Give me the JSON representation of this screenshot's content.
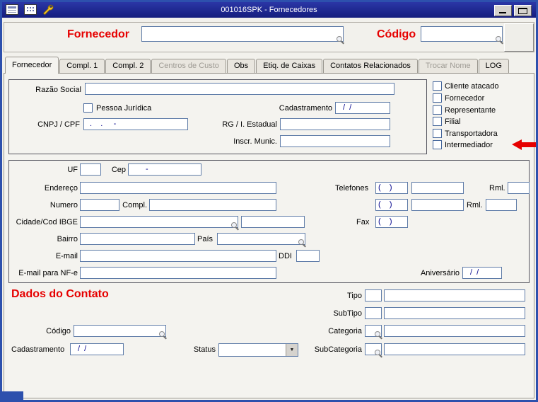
{
  "window": {
    "title": "001016SPK - Fornecedores"
  },
  "header": {
    "fornecedor_label": "Fornecedor",
    "codigo_label": "Código"
  },
  "tabs": [
    {
      "label": "Fornecedor",
      "state": "active"
    },
    {
      "label": "Compl. 1",
      "state": "normal"
    },
    {
      "label": "Compl. 2",
      "state": "normal"
    },
    {
      "label": "Centros de Custo",
      "state": "disabled"
    },
    {
      "label": "Obs",
      "state": "normal"
    },
    {
      "label": "Etiq. de Caixas",
      "state": "normal"
    },
    {
      "label": "Contatos Relacionados",
      "state": "normal"
    },
    {
      "label": "Trocar Nome",
      "state": "disabled"
    },
    {
      "label": "LOG",
      "state": "normal"
    }
  ],
  "identification": {
    "razao_social_label": "Razão Social",
    "pessoa_juridica_label": "Pessoa Jurídica",
    "cadastramento_label": "Cadastramento",
    "cadastramento_mask": "/  /",
    "cnpj_label": "CNPJ / CPF",
    "cnpj_mask": ".    .     -",
    "rg_label": "RG / I. Estadual",
    "inscr_label": "Inscr. Munic.",
    "flags": [
      "Cliente atacado",
      "Fornecedor",
      "Representante",
      "Filial",
      "Transportadora",
      "Intermediador"
    ]
  },
  "address": {
    "uf_label": "UF",
    "cep_label": "Cep",
    "cep_mask": "-",
    "endereco_label": "Endereço",
    "numero_label": "Numero",
    "compl_label": "Compl.",
    "cidade_label": "Cidade/Cod IBGE",
    "bairro_label": "Bairro",
    "pais_label": "País",
    "email_label": "E-mail",
    "ddi_label": "DDI",
    "email_nfe_label": "E-mail para NF-e",
    "telefones_label": "Telefones",
    "phone_mask": "(    )",
    "rml_label": "Rml.",
    "fax_label": "Fax",
    "aniversario_label": "Aniversário",
    "aniversario_mask": "/  /"
  },
  "contact": {
    "title": "Dados do Contato",
    "codigo_label": "Código",
    "cadastramento_label": "Cadastramento",
    "cadastramento_mask": "/  /",
    "status_label": "Status",
    "tipo_label": "Tipo",
    "subtipo_label": "SubTipo",
    "categoria_label": "Categoria",
    "subcategoria_label": "SubCategoria"
  },
  "colors": {
    "accent_red": "#e60000",
    "titlebar": "#151d7e",
    "mask_text": "#00008b",
    "field_border": "#5f7ca8"
  },
  "icons": {
    "titlebar": [
      "report-icon",
      "grid-icon",
      "wrench-icon"
    ],
    "lookup": "magnifier-icon",
    "annotation": "red-arrow-left-icon"
  }
}
